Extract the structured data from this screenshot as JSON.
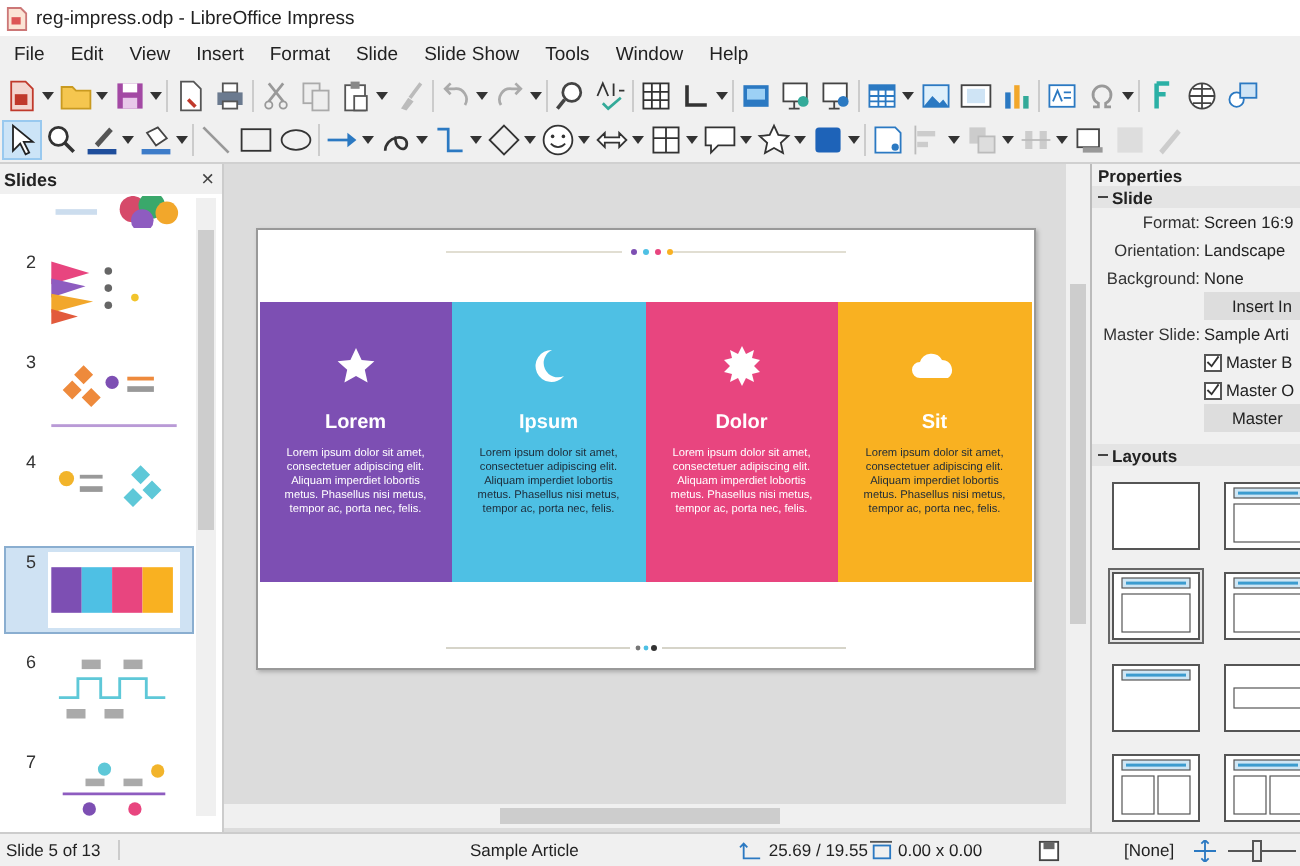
{
  "window": {
    "title": "reg-impress.odp - LibreOffice Impress"
  },
  "menu": [
    "File",
    "Edit",
    "View",
    "Insert",
    "Format",
    "Slide",
    "Slide Show",
    "Tools",
    "Window",
    "Help"
  ],
  "slides_panel": {
    "title": "Slides",
    "close": "×",
    "thumbnails": [
      {
        "kind": "photo",
        "selected": false
      },
      {
        "number": "2",
        "kind": "pinwheel",
        "selected": false
      },
      {
        "number": "3",
        "kind": "diamonds-right",
        "selected": false
      },
      {
        "number": "4",
        "kind": "diamonds-left",
        "selected": false
      },
      {
        "number": "5",
        "kind": "columns",
        "selected": true
      },
      {
        "number": "6",
        "kind": "steps",
        "selected": false
      },
      {
        "number": "7",
        "kind": "timeline",
        "selected": false
      }
    ]
  },
  "slide": {
    "columns": [
      {
        "kind": "star",
        "title": "Lorem",
        "text": "Lorem ipsum dolor sit amet, consectetuer adipiscing elit. Aliquam imperdiet lobortis metus. Phasellus nisi metus, tempor ac, porta nec, felis.",
        "color": "#7d4fb3",
        "dark_text": false
      },
      {
        "kind": "moon",
        "title": "Ipsum",
        "text": "Lorem ipsum dolor sit amet, consectetuer adipiscing elit. Aliquam imperdiet lobortis metus. Phasellus nisi metus, tempor ac, porta nec, felis.",
        "color": "#4ec0e4",
        "dark_text": true
      },
      {
        "kind": "sun",
        "title": "Dolor",
        "text": "Lorem ipsum dolor sit amet, consectetuer adipiscing elit. Aliquam imperdiet lobortis metus. Phasellus nisi metus, tempor ac, porta nec, felis.",
        "color": "#e8457f",
        "dark_text": false
      },
      {
        "kind": "cloud",
        "title": "Sit",
        "text": "Lorem ipsum dolor sit amet, consectetuer adipiscing elit. Aliquam imperdiet lobortis metus. Phasellus nisi metus, tempor ac, porta nec, felis.",
        "color": "#f9b121",
        "dark_text": true
      }
    ]
  },
  "properties": {
    "title": "Properties",
    "section": "Slide",
    "fields": [
      {
        "label": "Format:",
        "value": "Screen 16:9"
      },
      {
        "label": "Orientation:",
        "value": "Landscape"
      },
      {
        "label": "Background:",
        "value": "None"
      }
    ],
    "insert_button": "Insert In",
    "master_slide": {
      "label": "Master Slide:",
      "value": "Sample Arti"
    },
    "checkboxes": [
      {
        "label": "Master B",
        "checked": true
      },
      {
        "label": "Master O",
        "checked": true
      }
    ],
    "master_button": "Master",
    "layouts_title": "Layouts",
    "layouts": [
      {
        "kind": "blank",
        "selected": false
      },
      {
        "kind": "title-content",
        "selected": false
      },
      {
        "kind": "title-content",
        "selected": true
      },
      {
        "kind": "title-content",
        "selected": false
      },
      {
        "kind": "title-only",
        "selected": false
      },
      {
        "kind": "centered",
        "selected": false
      },
      {
        "kind": "title-two-content",
        "selected": false
      },
      {
        "kind": "title-two-content",
        "selected": false
      }
    ]
  },
  "status_bar": {
    "slide": "Slide 5 of 13",
    "master": "Sample Article",
    "position": "25.69 / 19.55",
    "size": "0.00 x 0.00",
    "language": "[None]",
    "zoom": {
      "level": 0.4
    }
  }
}
